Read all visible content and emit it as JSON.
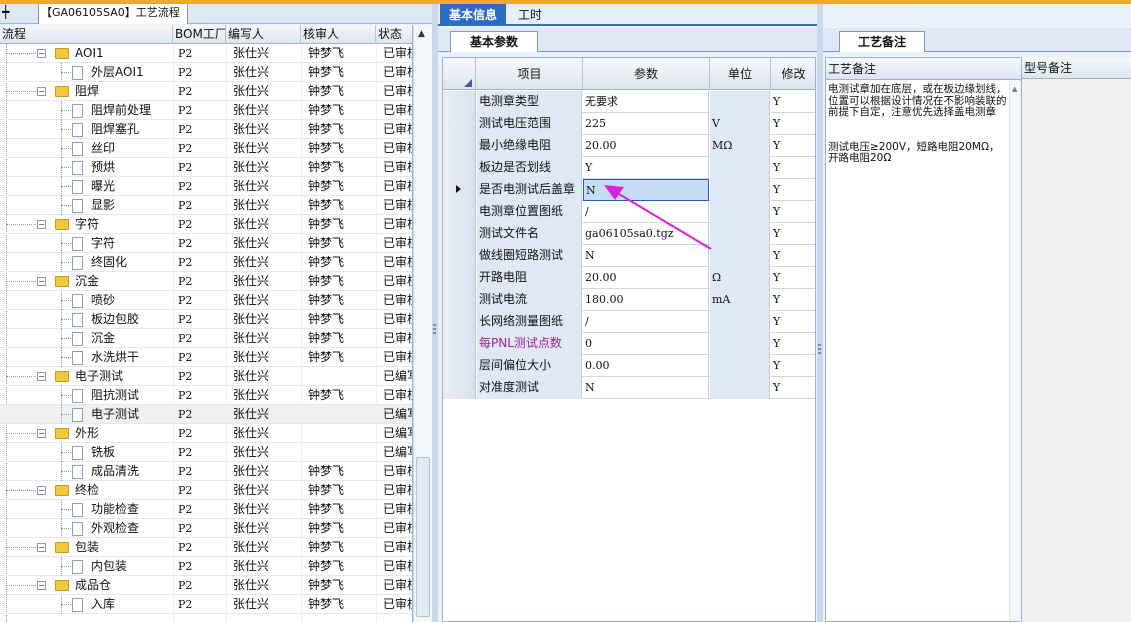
{
  "left_panel": {
    "tab_label": "【GA06105SA0】工艺流程",
    "columns": [
      "流程",
      "BOM工厂",
      "编写人",
      "核审人",
      "状态"
    ],
    "rows": [
      {
        "name": "AOI1",
        "level": 0,
        "bom": "P2",
        "writer": "张仕兴",
        "reviewer": "钟梦飞",
        "status": "已审核"
      },
      {
        "name": "外层AOI1",
        "level": 1,
        "bom": "P2",
        "writer": "张仕兴",
        "reviewer": "钟梦飞",
        "status": "已审核"
      },
      {
        "name": "阻焊",
        "level": 0,
        "bom": "P2",
        "writer": "张仕兴",
        "reviewer": "钟梦飞",
        "status": "已审核"
      },
      {
        "name": "阻焊前处理",
        "level": 1,
        "bom": "P2",
        "writer": "张仕兴",
        "reviewer": "钟梦飞",
        "status": "已审核"
      },
      {
        "name": "阻焊塞孔",
        "level": 1,
        "bom": "P2",
        "writer": "张仕兴",
        "reviewer": "钟梦飞",
        "status": "已审核"
      },
      {
        "name": "丝印",
        "level": 1,
        "bom": "P2",
        "writer": "张仕兴",
        "reviewer": "钟梦飞",
        "status": "已审核"
      },
      {
        "name": "预烘",
        "level": 1,
        "bom": "P2",
        "writer": "张仕兴",
        "reviewer": "钟梦飞",
        "status": "已审核"
      },
      {
        "name": "曝光",
        "level": 1,
        "bom": "P2",
        "writer": "张仕兴",
        "reviewer": "钟梦飞",
        "status": "已审核"
      },
      {
        "name": "显影",
        "level": 1,
        "bom": "P2",
        "writer": "张仕兴",
        "reviewer": "钟梦飞",
        "status": "已审核"
      },
      {
        "name": "字符",
        "level": 0,
        "bom": "P2",
        "writer": "张仕兴",
        "reviewer": "钟梦飞",
        "status": "已审核"
      },
      {
        "name": "字符",
        "level": 1,
        "bom": "P2",
        "writer": "张仕兴",
        "reviewer": "钟梦飞",
        "status": "已审核"
      },
      {
        "name": "终固化",
        "level": 1,
        "bom": "P2",
        "writer": "张仕兴",
        "reviewer": "钟梦飞",
        "status": "已审核"
      },
      {
        "name": "沉金",
        "level": 0,
        "bom": "P2",
        "writer": "张仕兴",
        "reviewer": "钟梦飞",
        "status": "已审核"
      },
      {
        "name": "喷砂",
        "level": 1,
        "bom": "P2",
        "writer": "张仕兴",
        "reviewer": "钟梦飞",
        "status": "已审核"
      },
      {
        "name": "板边包胶",
        "level": 1,
        "bom": "P2",
        "writer": "张仕兴",
        "reviewer": "钟梦飞",
        "status": "已审核"
      },
      {
        "name": "沉金",
        "level": 1,
        "bom": "P2",
        "writer": "张仕兴",
        "reviewer": "钟梦飞",
        "status": "已审核"
      },
      {
        "name": "水洗烘干",
        "level": 1,
        "bom": "P2",
        "writer": "张仕兴",
        "reviewer": "钟梦飞",
        "status": "已审核"
      },
      {
        "name": "电子测试",
        "level": 0,
        "bom": "P2",
        "writer": "张仕兴",
        "reviewer": "",
        "status": "已编写"
      },
      {
        "name": "阻抗测试",
        "level": 1,
        "bom": "P2",
        "writer": "张仕兴",
        "reviewer": "钟梦飞",
        "status": "已审核"
      },
      {
        "name": "电子测试",
        "level": 1,
        "bom": "P2",
        "writer": "张仕兴",
        "reviewer": "",
        "status": "已编写",
        "selected": true
      },
      {
        "name": "外形",
        "level": 0,
        "bom": "P2",
        "writer": "张仕兴",
        "reviewer": "",
        "status": "已编写"
      },
      {
        "name": "铣板",
        "level": 1,
        "bom": "P2",
        "writer": "张仕兴",
        "reviewer": "",
        "status": "已编写"
      },
      {
        "name": "成品清洗",
        "level": 1,
        "bom": "P2",
        "writer": "张仕兴",
        "reviewer": "钟梦飞",
        "status": "已审核"
      },
      {
        "name": "终检",
        "level": 0,
        "bom": "P2",
        "writer": "张仕兴",
        "reviewer": "钟梦飞",
        "status": "已审核"
      },
      {
        "name": "功能检查",
        "level": 1,
        "bom": "P2",
        "writer": "张仕兴",
        "reviewer": "钟梦飞",
        "status": "已审核"
      },
      {
        "name": "外观检查",
        "level": 1,
        "bom": "P2",
        "writer": "张仕兴",
        "reviewer": "钟梦飞",
        "status": "已审核"
      },
      {
        "name": "包装",
        "level": 0,
        "bom": "P2",
        "writer": "张仕兴",
        "reviewer": "钟梦飞",
        "status": "已审核"
      },
      {
        "name": "内包装",
        "level": 1,
        "bom": "P2",
        "writer": "张仕兴",
        "reviewer": "钟梦飞",
        "status": "已审核"
      },
      {
        "name": "成品仓",
        "level": 0,
        "bom": "P2",
        "writer": "张仕兴",
        "reviewer": "钟梦飞",
        "status": "已审核"
      },
      {
        "name": "入库",
        "level": 1,
        "bom": "P2",
        "writer": "张仕兴",
        "reviewer": "钟梦飞",
        "status": "已审核"
      }
    ]
  },
  "main_panel": {
    "tabs": [
      "基本信息",
      "工时"
    ],
    "subtab": "基本参数",
    "columns": [
      "项目",
      "参数",
      "单位",
      "修改"
    ],
    "rows": [
      {
        "item": "电测章类型",
        "value": "无要求",
        "unit": "",
        "mod": "Y"
      },
      {
        "item": "测试电压范围",
        "value": "225",
        "unit": "V",
        "mod": "Y"
      },
      {
        "item": "最小绝缘电阻",
        "value": "20.00",
        "unit": "MΩ",
        "mod": "Y"
      },
      {
        "item": "板边是否划线",
        "value": "Y",
        "unit": "",
        "mod": "Y"
      },
      {
        "item": "是否电测试后盖章",
        "value": "N",
        "unit": "",
        "mod": "Y",
        "current": true
      },
      {
        "item": "电测章位置图纸",
        "value": "/",
        "unit": "",
        "mod": "Y"
      },
      {
        "item": "测试文件名",
        "value": "ga06105sa0.tgz",
        "unit": "",
        "mod": "Y"
      },
      {
        "item": "做线圈短路测试",
        "value": "N",
        "unit": "",
        "mod": "Y"
      },
      {
        "item": "开路电阻",
        "value": "20.00",
        "unit": "Ω",
        "mod": "Y"
      },
      {
        "item": "测试电流",
        "value": "180.00",
        "unit": "mA",
        "mod": "Y"
      },
      {
        "item": "长网络测量图纸",
        "value": "/",
        "unit": "",
        "mod": "Y"
      },
      {
        "item": "每PNL测试点数",
        "value": "0",
        "unit": "",
        "mod": "Y",
        "highlight": true
      },
      {
        "item": "层间偏位大小",
        "value": "0.00",
        "unit": "",
        "mod": "Y"
      },
      {
        "item": "对准度测试",
        "value": "N",
        "unit": "",
        "mod": "Y"
      }
    ]
  },
  "right_panel": {
    "tab_label": "工艺备注",
    "note_header": "工艺备注",
    "note_text": "电测试章加在底层，或在板边缘划线，位置可以根据设计情况在不影响装联的前提下自定，注意优先选择盖电测章\n\n\n测试电压≥200V，短路电阻20MΩ，开路电阻20Ω",
    "model_header": "型号备注"
  },
  "colors": {
    "accent": "#2b6cc2",
    "annotation_arrow": "#e020e0",
    "top_strip": "#f0a830"
  }
}
